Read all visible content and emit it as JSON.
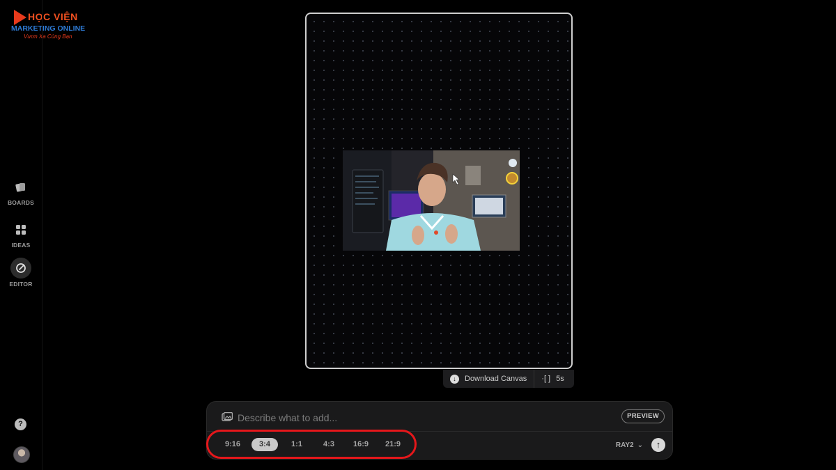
{
  "logo": {
    "line1": "HỌC VIỆN",
    "line2": "MARKETING ONLINE",
    "line3": "Vươn Xa Cùng Bạn"
  },
  "sidebar": {
    "items": [
      {
        "label": "BOARDS",
        "icon": "boards-icon"
      },
      {
        "label": "IDEAS",
        "icon": "ideas-icon"
      },
      {
        "label": "EDITOR",
        "icon": "editor-icon",
        "active": true
      }
    ],
    "help_label": "?"
  },
  "canvas": {
    "download_label": "Download Canvas",
    "duration": "5s"
  },
  "prompt": {
    "placeholder": "Describe what to add...",
    "preview_label": "PREVIEW",
    "aspect_ratios": [
      "9:16",
      "3:4",
      "1:1",
      "4:3",
      "16:9",
      "21:9"
    ],
    "selected_ratio": "3:4",
    "model": "RAY2"
  },
  "colors": {
    "background": "#000000",
    "highlight": "#e5171b",
    "panel": "#1a1a1b"
  }
}
